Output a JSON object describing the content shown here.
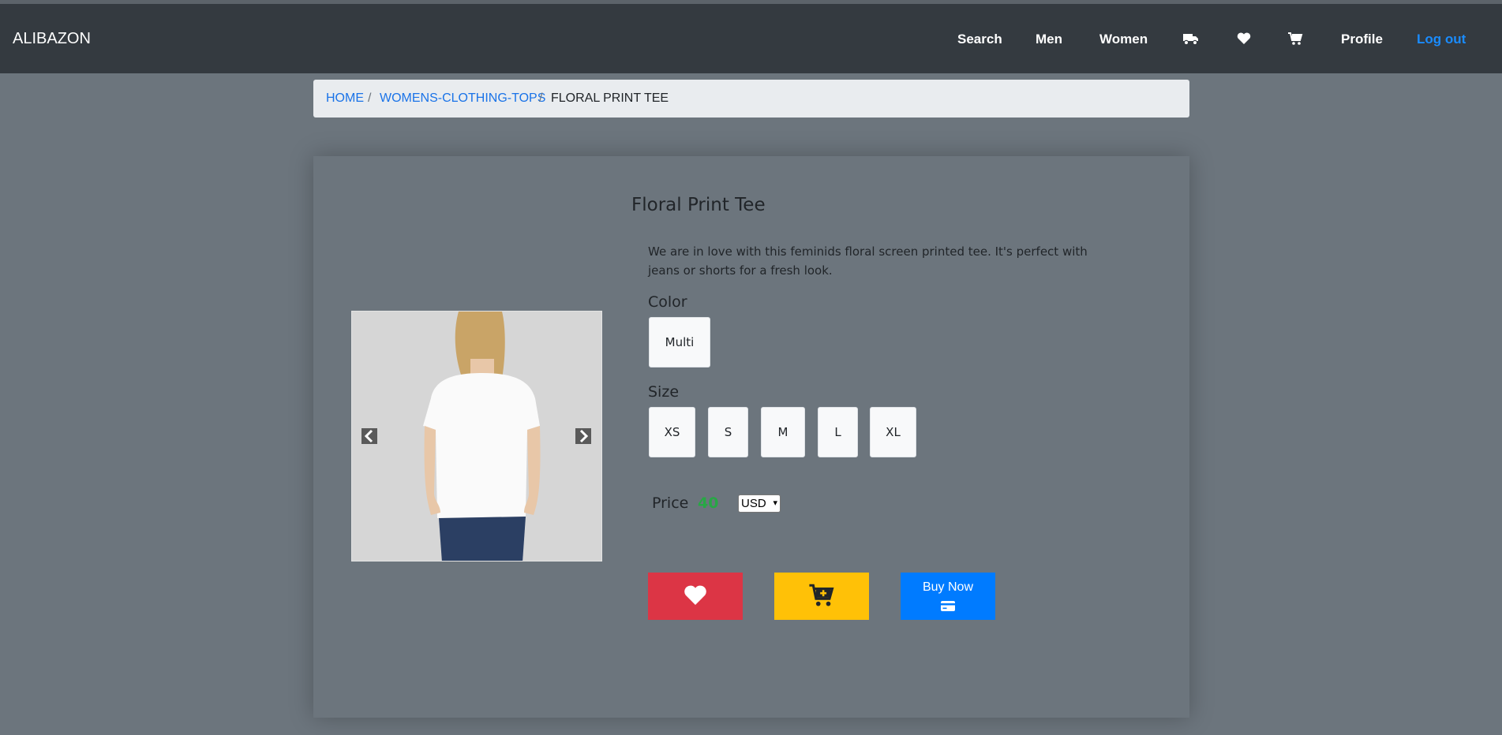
{
  "navbar": {
    "brand": "ALIBAZON",
    "links": {
      "search": "Search",
      "men": "Men",
      "women": "Women",
      "profile": "Profile",
      "logout": "Log out"
    },
    "icons": [
      "truck-icon",
      "heart-icon",
      "cart-icon"
    ],
    "logout_color": "#1a8cff"
  },
  "breadcrumb": {
    "home": "HOME",
    "sep": "/",
    "category": "WOMENS-CLOTHING-TOPS",
    "current": "FLORAL PRINT TEE"
  },
  "product": {
    "title": "Floral Print Tee",
    "description": "We are in love with this feminids floral screen printed tee. It's perfect with jeans or shorts for a fresh look.",
    "color_label": "Color",
    "colors": [
      "Multi"
    ],
    "size_label": "Size",
    "sizes": [
      "XS",
      "S",
      "M",
      "L",
      "XL"
    ],
    "price_label": "Price",
    "price": "40",
    "currency": "USD"
  },
  "actions": {
    "buy_now": "Buy Now"
  },
  "colors": {
    "navbar_bg": "#343a40",
    "page_bg": "#6c757d",
    "like_btn": "#dc3545",
    "cart_btn": "#ffc107",
    "buy_btn": "#007bff",
    "price": "#28a745"
  }
}
